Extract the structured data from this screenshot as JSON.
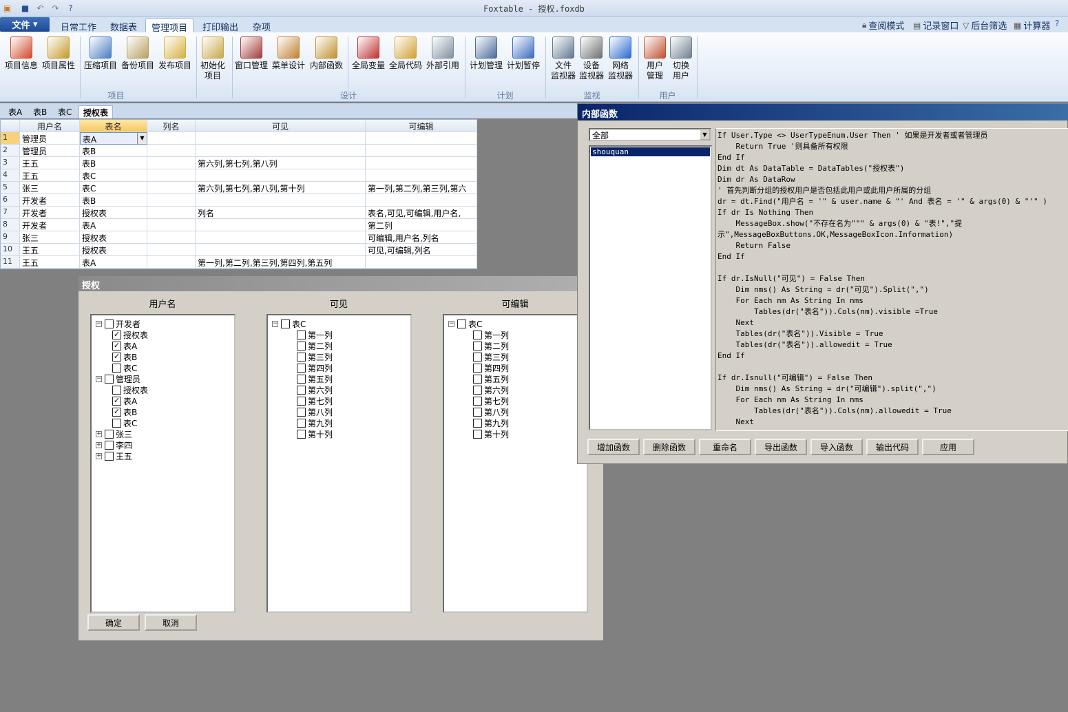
{
  "title": "Foxtable - 授权.foxdb",
  "menu": {
    "file": "文件",
    "tabs": [
      "日常工作",
      "数据表",
      "管理项目",
      "打印输出",
      "杂项"
    ],
    "right_tools": [
      "查阅模式",
      "记录窗口",
      "后台筛选",
      "计算器"
    ]
  },
  "ribbon": {
    "buttons": [
      {
        "label": "项目信息",
        "icon": "ribbon-certificate-icon",
        "color": "#d24a2b"
      },
      {
        "label": "项目属性",
        "icon": "ribbon-properties-icon",
        "color": "#c49a2c"
      },
      {
        "label": "压缩项目",
        "icon": "ribbon-compress-icon",
        "color": "#4a7dc4"
      },
      {
        "label": "备份项目",
        "icon": "ribbon-backup-icon",
        "color": "#b8a060"
      },
      {
        "label": "发布项目",
        "icon": "ribbon-publish-icon",
        "color": "#d8b040"
      },
      {
        "label": "初始化",
        "label2": "项目",
        "icon": "ribbon-init-icon",
        "color": "#c9a84a"
      },
      {
        "label": "窗口管理",
        "icon": "ribbon-window-icon",
        "color": "#a23a3a"
      },
      {
        "label": "菜单设计",
        "icon": "ribbon-tools-icon",
        "color": "#c08030"
      },
      {
        "label": "内部函数",
        "icon": "ribbon-function-icon",
        "color": "#c09030"
      },
      {
        "label": "全局变量",
        "icon": "ribbon-variable-icon",
        "color": "#c03030"
      },
      {
        "label": "全局代码",
        "icon": "ribbon-code-icon",
        "color": "#d0a030"
      },
      {
        "label": "外部引用",
        "icon": "ribbon-reference-icon",
        "color": "#8090a0"
      },
      {
        "label": "计划管理",
        "icon": "ribbon-calendar-icon",
        "color": "#4a6a9a"
      },
      {
        "label": "计划暂停",
        "icon": "ribbon-pause-icon",
        "color": "#3a6ac0"
      },
      {
        "label": "文件",
        "label2": "监视器",
        "icon": "ribbon-file-monitor-icon",
        "color": "#607890"
      },
      {
        "label": "设备",
        "label2": "监视器",
        "icon": "ribbon-device-monitor-icon",
        "color": "#707070"
      },
      {
        "label": "网络",
        "label2": "监视器",
        "icon": "ribbon-globe-icon",
        "color": "#2a6ad0"
      },
      {
        "label": "用户",
        "label2": "管理",
        "icon": "ribbon-users-icon",
        "color": "#c05030"
      },
      {
        "label": "切换",
        "label2": "用户",
        "icon": "ribbon-switch-user-icon",
        "color": "#708090"
      }
    ],
    "groups": [
      "项目",
      "设计",
      "计划",
      "监视",
      "用户"
    ]
  },
  "sheet_tabs": [
    "表A",
    "表B",
    "表C",
    "授权表"
  ],
  "grid": {
    "columns": [
      "用户名",
      "表名",
      "列名",
      "可见",
      "可编辑"
    ],
    "rows": [
      [
        "1",
        "管理员",
        "表A",
        "",
        "",
        ""
      ],
      [
        "2",
        "管理员",
        "表B",
        "",
        "",
        ""
      ],
      [
        "3",
        "王五",
        "表B",
        "",
        "第六列,第七列,第八列",
        ""
      ],
      [
        "4",
        "王五",
        "表C",
        "",
        "",
        ""
      ],
      [
        "5",
        "张三",
        "表C",
        "",
        "第六列,第七列,第八列,第十列",
        "第一列,第二列,第三列,第六"
      ],
      [
        "6",
        "开发者",
        "表B",
        "",
        "",
        ""
      ],
      [
        "7",
        "开发者",
        "授权表",
        "",
        "列名",
        "表名,可见,可编辑,用户名,"
      ],
      [
        "8",
        "开发者",
        "表A",
        "",
        "",
        "第二列"
      ],
      [
        "9",
        "张三",
        "授权表",
        "",
        "",
        "可编辑,用户名,列名"
      ],
      [
        "10",
        "王五",
        "授权表",
        "",
        "",
        "可见,可编辑,列名"
      ],
      [
        "11",
        "王五",
        "表A",
        "",
        "第一列,第二列,第三列,第四列,第五列",
        ""
      ]
    ]
  },
  "auth_dialog": {
    "title": "授权",
    "col_users": "用户名",
    "col_visible": "可见",
    "col_editable": "可编辑",
    "user_tree": [
      {
        "label": "开发者",
        "level": 0,
        "exp": "−",
        "checked": false
      },
      {
        "label": "授权表",
        "level": 1,
        "checked": true
      },
      {
        "label": "表A",
        "level": 1,
        "checked": true
      },
      {
        "label": "表B",
        "level": 1,
        "checked": true
      },
      {
        "label": "表C",
        "level": 1,
        "checked": false
      },
      {
        "label": "管理员",
        "level": 0,
        "exp": "−",
        "checked": false
      },
      {
        "label": "授权表",
        "level": 1,
        "checked": false
      },
      {
        "label": "表A",
        "level": 1,
        "checked": true
      },
      {
        "label": "表B",
        "level": 1,
        "checked": true
      },
      {
        "label": "表C",
        "level": 1,
        "checked": false
      },
      {
        "label": "张三",
        "level": 0,
        "exp": "+",
        "checked": false
      },
      {
        "label": "李四",
        "level": 0,
        "exp": "+",
        "checked": false
      },
      {
        "label": "王五",
        "level": 0,
        "exp": "+",
        "checked": false
      }
    ],
    "table_root": "表C",
    "columns_list": [
      "第一列",
      "第二列",
      "第三列",
      "第四列",
      "第五列",
      "第六列",
      "第七列",
      "第八列",
      "第九列",
      "第十列"
    ],
    "ok": "确定",
    "cancel": "取消"
  },
  "func_dialog": {
    "title": "内部函数",
    "filter": "全部",
    "functions": [
      "shouquan"
    ],
    "code": [
      "If User.Type <> UserTypeEnum.User Then ' 如果是开发者或者管理员",
      "    Return True '则具备所有权限",
      "End If",
      "Dim dt As DataTable = DataTables(\"授权表\")",
      "Dim dr As DataRow",
      "' 首先判断分组的授权用户是否包括此用户或此用户所属的分组",
      "dr = dt.Find(\"用户名 = '\" & user.name & \"' And 表名 = '\" & args(0) & \"'\" )",
      "If dr Is Nothing Then",
      "    MessageBox.show(\"不存在名为\"\"\" & args(0) & \"表!\",\"提",
      "示\",MessageBoxButtons.OK,MessageBoxIcon.Information)",
      "    Return False",
      "End If",
      "",
      "If dr.IsNull(\"可见\") = False Then",
      "    Dim nms() As String = dr(\"可见\").Split(\",\")",
      "    For Each nm As String In nms",
      "        Tables(dr(\"表名\")).Cols(nm).visible =True",
      "    Next",
      "    Tables(dr(\"表名\")).Visible = True",
      "    Tables(dr(\"表名\")).allowedit = True",
      "End If",
      "",
      "If dr.Isnull(\"可编辑\") = False Then",
      "    Dim nms() As String = dr(\"可编辑\").split(\",\")",
      "    For Each nm As String In nms",
      "        Tables(dr(\"表名\")).Cols(nm).allowedit = True",
      "    Next"
    ],
    "buttons": [
      "增加函数",
      "删除函数",
      "重命名",
      "导出函数",
      "导入函数",
      "输出代码",
      "应用"
    ]
  }
}
